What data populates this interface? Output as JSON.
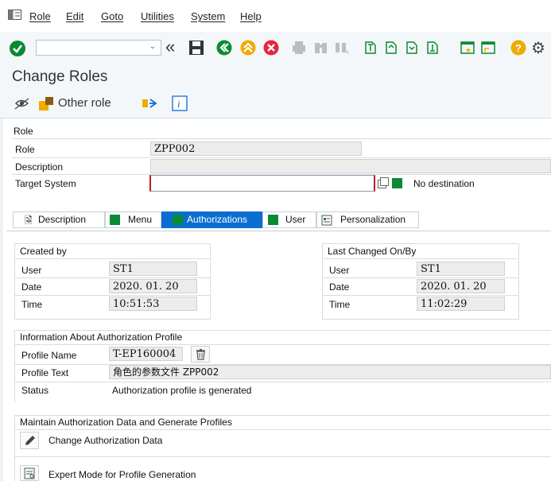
{
  "menu": [
    "Role",
    "Edit",
    "Goto",
    "Utilities",
    "System",
    "Help"
  ],
  "title": "Change Roles",
  "app_toolbar": {
    "other_role": "Other role"
  },
  "role_section": {
    "heading": "Role",
    "role_label": "Role",
    "role_value": "ZPP002",
    "description_label": "Description",
    "description_value": "",
    "target_label": "Target System",
    "target_value": "",
    "no_destination": "No destination"
  },
  "tabs": [
    "Description",
    "Menu",
    "Authorizations",
    "User",
    "Personalization"
  ],
  "created": {
    "heading": "Created by",
    "user_label": "User",
    "user": "ST1",
    "date_label": "Date",
    "date": "2020. 01. 20",
    "time_label": "Time",
    "time": "10:51:53"
  },
  "changed": {
    "heading": "Last Changed On/By",
    "user_label": "User",
    "user": "ST1",
    "date_label": "Date",
    "date": "2020. 01. 20",
    "time_label": "Time",
    "time": "11:02:29"
  },
  "profile": {
    "heading": "Information About Authorization Profile",
    "name_label": "Profile Name",
    "name": "T-EP160004",
    "text_label": "Profile Text",
    "text": "角色的参数文件 ZPP002",
    "status_label": "Status",
    "status": "Authorization profile is generated"
  },
  "maintain": {
    "heading": "Maintain Authorization Data and Generate Profiles",
    "change_data": "Change Authorization Data",
    "expert_mode": "Expert Mode for Profile Generation"
  },
  "colors": {
    "green": "#0b8a35",
    "active_tab": "#0a6ed1",
    "orange": "#f0ab00",
    "red": "#e3273e"
  }
}
